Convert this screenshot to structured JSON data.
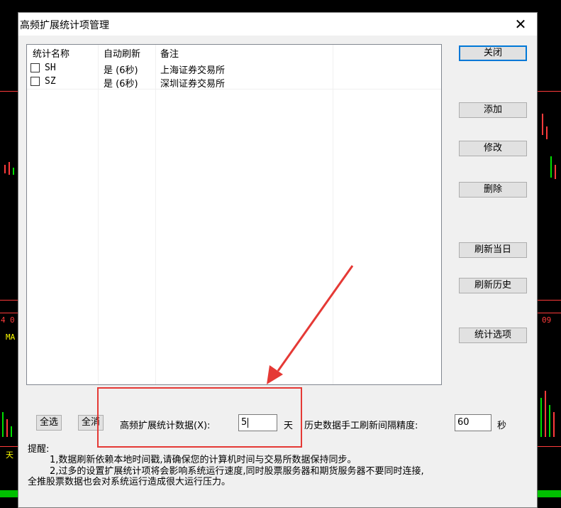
{
  "window": {
    "title": "高频扩展统计项管理",
    "close_glyph": "✕"
  },
  "list": {
    "headers": [
      "统计名称",
      "自动刷新",
      "备注"
    ],
    "rows": [
      {
        "name": "SH",
        "auto": "是 (6秒)",
        "note": "上海证券交易所",
        "checked": false
      },
      {
        "name": "SZ",
        "auto": "是 (6秒)",
        "note": "深圳证券交易所",
        "checked": false
      }
    ]
  },
  "buttons": {
    "close": "关闭",
    "add": "添加",
    "modify": "修改",
    "delete": "删除",
    "refresh_today": "刷新当日",
    "refresh_history": "刷新历史",
    "stat_options": "统计选项",
    "select_all": "全选",
    "clear_all": "全消"
  },
  "settings": {
    "ext_label": "高频扩展统计数据(X):",
    "ext_value": "5",
    "ext_unit": "天",
    "interval_label": "历史数据手工刷新间隔精度:",
    "interval_value": "60",
    "interval_unit": "秒"
  },
  "notes": {
    "heading": "提醒:",
    "line1": "1,数据刷新依赖本地时间戳,请确保您的计算机时间与交易所数据保持同步。",
    "line2": "2,过多的设置扩展统计项将会影响系统运行速度,同时股票服务器和期货服务器不要同时连接,",
    "line3": "全推股票数据也会对系统运行造成很大运行压力。"
  },
  "background": {
    "left_labels": [
      "4",
      "0",
      "MA",
      "天"
    ],
    "right_labels": [
      "09"
    ]
  },
  "colors": {
    "highlight": "#e53935",
    "chart_red": "#ff3b3b",
    "chart_green": "#00e000",
    "chart_yellow": "#ffff00",
    "dialog_bg": "#f0f0f0"
  }
}
